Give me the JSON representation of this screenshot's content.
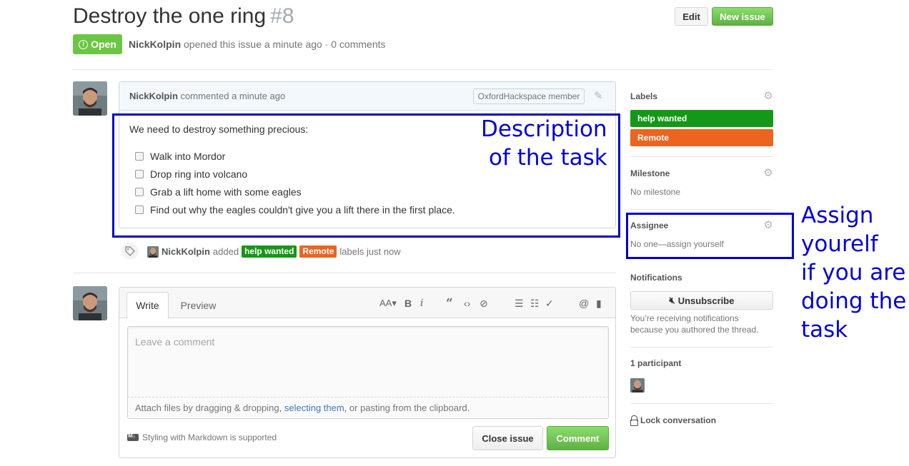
{
  "header": {
    "title": "Destroy the one ring",
    "number": "#8",
    "edit_label": "Edit",
    "new_issue_label": "New issue",
    "state": "Open",
    "author": "NickKolpin",
    "meta_rest": "opened this issue a minute ago · 0 comments"
  },
  "comment": {
    "author": "NickKolpin",
    "action": "commented a minute ago",
    "member_badge": "OxfordHackspace member",
    "intro": "We need to destroy something precious:",
    "tasks": [
      "Walk into Mordor",
      "Drop ring into volcano",
      "Grab a lift home with some eagles",
      "Find out why the eagles couldn't give you a lift there in the first place."
    ]
  },
  "event": {
    "author": "NickKolpin",
    "verb": "added",
    "labels": [
      {
        "name": "help wanted",
        "color": "#159818"
      },
      {
        "name": "Remote",
        "color": "#eb6420"
      }
    ],
    "suffix": "labels just now"
  },
  "editor": {
    "tab_write": "Write",
    "tab_preview": "Preview",
    "placeholder": "Leave a comment",
    "attach_pre": "Attach files by dragging & dropping, ",
    "attach_link": "selecting them",
    "attach_post": ", or pasting from the clipboard.",
    "markdown_hint": "Styling with Markdown is supported",
    "close_label": "Close issue",
    "comment_label": "Comment"
  },
  "sidebar": {
    "labels_heading": "Labels",
    "labels": [
      {
        "name": "help wanted",
        "color": "#159818"
      },
      {
        "name": "Remote",
        "color": "#eb6420"
      }
    ],
    "milestone_heading": "Milestone",
    "milestone_value": "No milestone",
    "assignee_heading": "Assignee",
    "assignee_value": "No one—assign yourself",
    "notifications_heading": "Notifications",
    "unsubscribe_label": "Unsubscribe",
    "notif_line1": "You’re receiving notifications",
    "notif_line2": "because you authored the thread.",
    "participants_heading": "1 participant",
    "lock_label": "Lock conversation"
  },
  "annotations": {
    "description_line1": "Description",
    "description_line2": "of the task",
    "assign_line1": "Assign",
    "assign_line2": "yourelf",
    "assign_line3": "if you are",
    "assign_line4": "doing the",
    "assign_line5": "task",
    "color": "#0000dd"
  }
}
